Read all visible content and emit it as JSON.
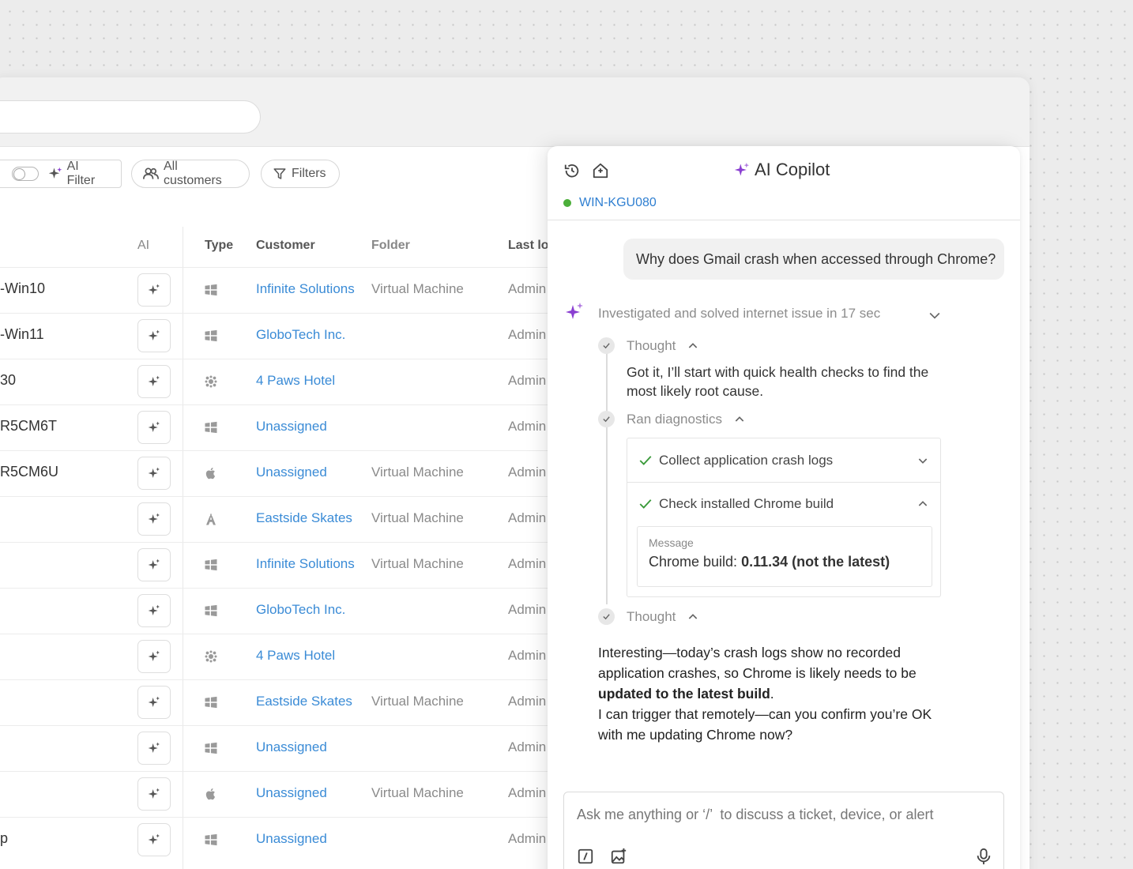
{
  "toolbar": {
    "ai_filter_label": "AI Filter",
    "customers_label": "All customers",
    "filters_label": "Filters"
  },
  "table": {
    "headers": {
      "ai": "AI",
      "type": "Type",
      "customer": "Customer",
      "folder": "Folder",
      "last": "Last lo"
    },
    "rows": [
      {
        "name": "-Win10",
        "os": "windows",
        "customer": "Infinite Solutions",
        "folder": "Virtual Machine",
        "last": "Admin"
      },
      {
        "name": "-Win11",
        "os": "windows",
        "customer": "GloboTech Inc.",
        "folder": "",
        "last": "Admin"
      },
      {
        "name": "30",
        "os": "linux",
        "customer": "4 Paws Hotel",
        "folder": "",
        "last": "Admin"
      },
      {
        "name": "R5CM6T",
        "os": "windows",
        "customer": "Unassigned",
        "folder": "",
        "last": "Admin"
      },
      {
        "name": "R5CM6U",
        "os": "apple",
        "customer": "Unassigned",
        "folder": "Virtual Machine",
        "last": "Admin"
      },
      {
        "name": "",
        "os": "android",
        "customer": "Eastside Skates",
        "folder": "Virtual Machine",
        "last": "Admin"
      },
      {
        "name": "",
        "os": "windows",
        "customer": "Infinite Solutions",
        "folder": "Virtual Machine",
        "last": "Admin"
      },
      {
        "name": "",
        "os": "windows",
        "customer": "GloboTech Inc.",
        "folder": "",
        "last": "Admin"
      },
      {
        "name": "",
        "os": "linux",
        "customer": "4 Paws Hotel",
        "folder": "",
        "last": "Admin"
      },
      {
        "name": "",
        "os": "windows",
        "customer": "Eastside Skates",
        "folder": "Virtual Machine",
        "last": "Admin"
      },
      {
        "name": "",
        "os": "windows",
        "customer": "Unassigned",
        "folder": "",
        "last": "Admin"
      },
      {
        "name": "",
        "os": "apple",
        "customer": "Unassigned",
        "folder": "Virtual Machine",
        "last": "Admin"
      },
      {
        "name": "p",
        "os": "windows",
        "customer": "Unassigned",
        "folder": "",
        "last": "Admin"
      }
    ]
  },
  "copilot": {
    "title": "AI Copilot",
    "device": "WIN-KGU080",
    "user_message": "Why does Gmail crash when accessed through Chrome?",
    "summary": "Investigated and solved internet issue in 17 sec",
    "thought_label": "Thought",
    "thought_text": "Got it, I’ll start with quick health checks to find the most likely root cause.",
    "diagnostics_label": "Ran diagnostics",
    "diagnostics": [
      {
        "label": "Collect application crash logs",
        "status": "done"
      },
      {
        "label": "Check installed Chrome build",
        "status": "done"
      }
    ],
    "message_label": "Message",
    "message_prefix": "Chrome build: ",
    "message_value": "0.11.34 (not the latest)",
    "thought2_label": "Thought",
    "final_part1": "Interesting—today’s crash logs show no recorded application crashes, so Chrome is likely needs to be ",
    "final_bold": "updated to the latest build",
    "final_part2": ".",
    "final_part3": "I can trigger that remotely—can you confirm you’re OK with me updating Chrome now?",
    "input_placeholder": "Ask me anything or ‘/’  to discuss a ticket, device, or alert"
  },
  "colors": {
    "accent": "#8a3fd1",
    "link": "#3a8bd6",
    "online": "#4caf3a",
    "check": "#3a9a3a"
  }
}
